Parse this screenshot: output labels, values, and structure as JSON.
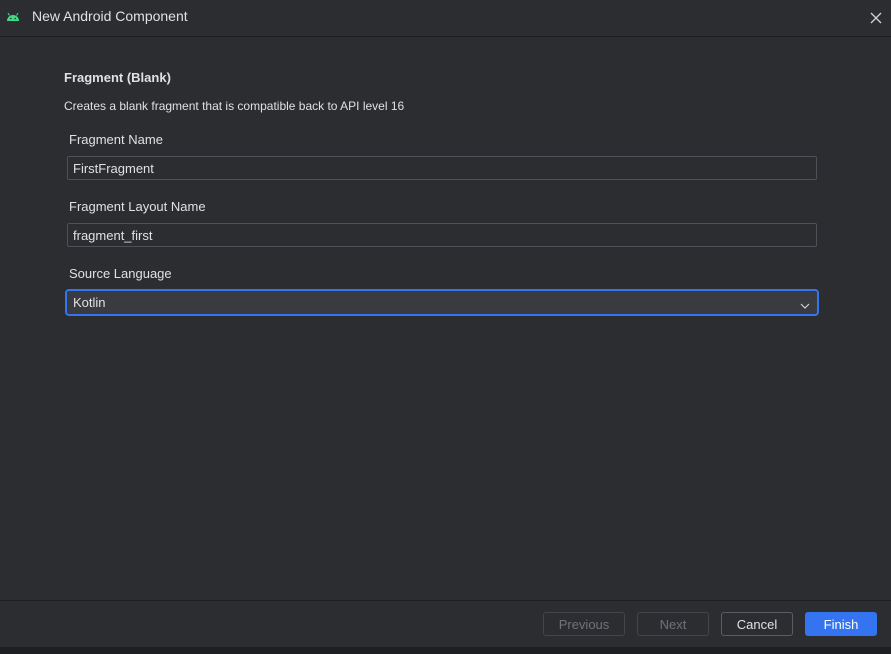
{
  "window": {
    "title": "New Android Component",
    "icon": "android-icon",
    "close_icon": "close-icon",
    "accent_color": "#3574f0",
    "android_color": "#3ddc84"
  },
  "form": {
    "heading": "Fragment (Blank)",
    "description": "Creates a blank fragment that is compatible back to API level 16",
    "fragment_name": {
      "label": "Fragment Name",
      "value": "FirstFragment"
    },
    "layout_name": {
      "label": "Fragment Layout Name",
      "value": "fragment_first"
    },
    "source_language": {
      "label": "Source Language",
      "value": "Kotlin"
    }
  },
  "footer": {
    "previous_label": "Previous",
    "next_label": "Next",
    "cancel_label": "Cancel",
    "finish_label": "Finish"
  }
}
